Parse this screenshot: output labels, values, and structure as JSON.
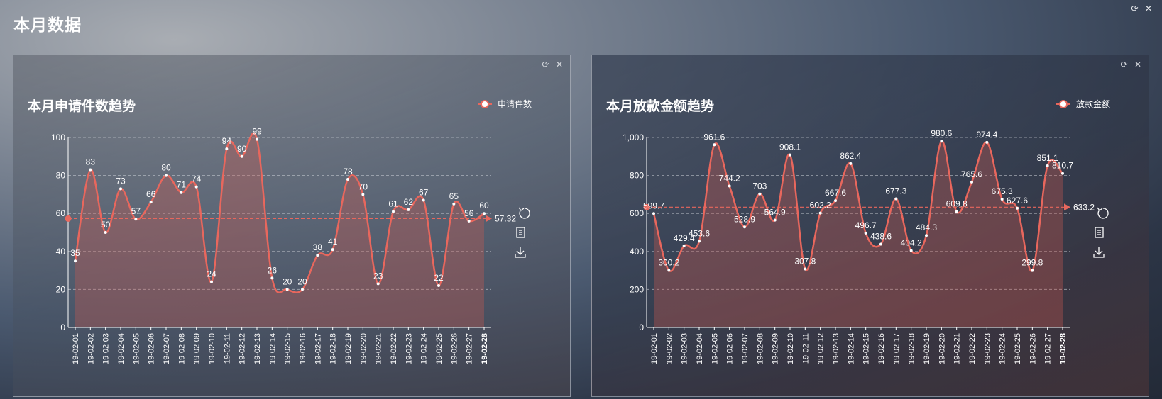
{
  "page": {
    "title": "本月数据",
    "tools": {
      "refresh": "⟳",
      "close": "✕"
    }
  },
  "colors": {
    "series": "#e8675d",
    "text": "#ffffff"
  },
  "chart_data": [
    {
      "type": "line",
      "title": "本月申请件数趋势",
      "legend": "申请件数",
      "legend_position": "top-right",
      "smooth": true,
      "area": true,
      "grid": true,
      "ylim": [
        0,
        100
      ],
      "yticks": [
        0,
        20,
        40,
        60,
        80,
        100
      ],
      "ytick_labels": [
        "0",
        "20",
        "40",
        "60",
        "80",
        "100"
      ],
      "categories": [
        "19-02-01",
        "19-02-02",
        "19-02-03",
        "19-02-04",
        "19-02-05",
        "19-02-06",
        "19-02-07",
        "19-02-08",
        "19-02-09",
        "19-02-10",
        "19-02-11",
        "19-02-12",
        "19-02-13",
        "19-02-14",
        "19-02-15",
        "19-02-16",
        "19-02-17",
        "19-02-18",
        "19-02-19",
        "19-02-20",
        "19-02-21",
        "19-02-22",
        "19-02-23",
        "19-02-24",
        "19-02-25",
        "19-02-26",
        "19-02-27",
        "19-02-28"
      ],
      "values": [
        35,
        83,
        50,
        73,
        57,
        66,
        80,
        71,
        74,
        24,
        94,
        90,
        99,
        26,
        20,
        20,
        38,
        41,
        78,
        70,
        23,
        61,
        62,
        67,
        22,
        65,
        56,
        60
      ],
      "labels": [
        "35",
        "83",
        "50",
        "73",
        "57",
        "66",
        "80",
        "71",
        "74",
        "24",
        "94",
        "90",
        "99",
        "26",
        "20",
        "20",
        "38",
        "41",
        "78",
        "70",
        "23",
        "61",
        "62",
        "67",
        "22",
        "65",
        "56",
        "60"
      ],
      "mean": 57.32,
      "mean_label": "57.32"
    },
    {
      "type": "line",
      "title": "本月放款金额趋势",
      "legend": "放款金额",
      "legend_position": "top-right",
      "smooth": true,
      "area": true,
      "grid": true,
      "ylim": [
        0,
        1000
      ],
      "yticks": [
        0,
        200,
        400,
        600,
        800,
        1000
      ],
      "ytick_labels": [
        "0",
        "200",
        "400",
        "600",
        "800",
        "1,000"
      ],
      "categories": [
        "19-02-01",
        "19-02-02",
        "19-02-03",
        "19-02-04",
        "19-02-05",
        "19-02-06",
        "19-02-07",
        "19-02-08",
        "19-02-09",
        "19-02-10",
        "19-02-11",
        "19-02-12",
        "19-02-13",
        "19-02-14",
        "19-02-15",
        "19-02-16",
        "19-02-17",
        "19-02-18",
        "19-02-19",
        "19-02-20",
        "19-02-21",
        "19-02-22",
        "19-02-23",
        "19-02-24",
        "19-02-25",
        "19-02-26",
        "19-02-27",
        "19-02-28"
      ],
      "values": [
        599.7,
        300.2,
        429.4,
        453.6,
        961.6,
        744.2,
        528.9,
        703,
        564.9,
        908.1,
        307.8,
        602.2,
        667.6,
        862.4,
        496.7,
        438.6,
        677.3,
        404.2,
        484.3,
        980.6,
        609.8,
        765.6,
        974.4,
        675.3,
        627.6,
        299.8,
        851.1,
        810.7
      ],
      "labels": [
        "599.7",
        "300.2",
        "429.4",
        "453.6",
        "961.6",
        "744.2",
        "528.9",
        "703",
        "564.9",
        "908.1",
        "307.8",
        "602.2",
        "667.6",
        "862.4",
        "496.7",
        "438.6",
        "677.3",
        "404.2",
        "484.3",
        "980.6",
        "609.8",
        "765.6",
        "974.4",
        "675.3",
        "627.6",
        "299.8",
        "851.1",
        "810.7"
      ],
      "mean": 633.2,
      "mean_label": "633.2"
    }
  ]
}
